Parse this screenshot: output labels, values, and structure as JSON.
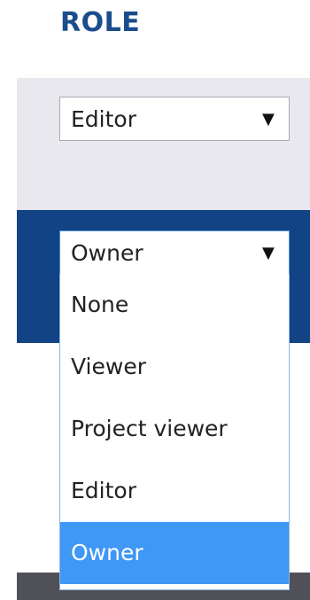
{
  "header": {
    "title": "ROLE"
  },
  "rows": [
    {
      "role_value": "Editor"
    },
    {
      "role_value": "Owner"
    }
  ],
  "select_arrow_glyph": "▼",
  "dropdown": {
    "options": [
      "None",
      "Viewer",
      "Project viewer",
      "Editor",
      "Owner"
    ],
    "highlighted_option": "Owner"
  },
  "colors": {
    "header_text": "#1a4d8c",
    "row_light_bg": "#e8e8ee",
    "row_selected_bg": "#124385",
    "highlight_bg": "#3f97f6",
    "footer_bg": "#505058"
  }
}
